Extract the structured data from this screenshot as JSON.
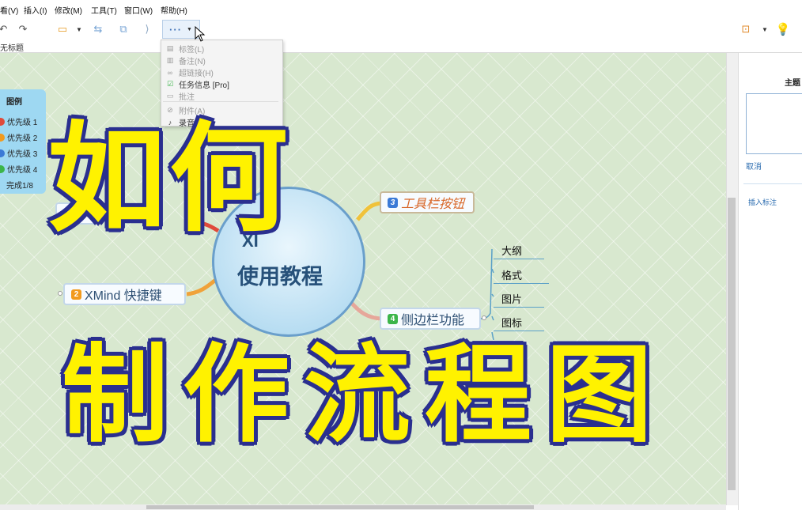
{
  "menu": [
    "看(V)",
    "插入(I)",
    "修改(M)",
    "工具(T)",
    "窗口(W)",
    "帮助(H)"
  ],
  "toolbar": {
    "more_label": "···"
  },
  "doc_tab": "无标题",
  "dropdown": {
    "items": [
      {
        "label": "标签(L)",
        "icon": "tag-icon",
        "enabled": false
      },
      {
        "label": "备注(N)",
        "icon": "note-icon",
        "enabled": false
      },
      {
        "label": "超链接(H)",
        "icon": "link-icon",
        "enabled": false
      },
      {
        "label": "任务信息 [Pro]",
        "icon": "task-icon",
        "enabled": true
      },
      {
        "label": "批注",
        "icon": "comment-icon",
        "enabled": false
      },
      {
        "label": "附件(A)",
        "icon": "paperclip-icon",
        "enabled": false
      },
      {
        "label": "录音 [Pro]",
        "icon": "mic-icon",
        "enabled": true
      }
    ]
  },
  "legend": {
    "title": "图例",
    "items": [
      {
        "label": "优先级 1",
        "color": "#e04a3a"
      },
      {
        "label": "优先级 2",
        "color": "#f29a1d"
      },
      {
        "label": "优先级 3",
        "color": "#3b7ad6"
      },
      {
        "label": "优先级 4",
        "color": "#3cb54a"
      },
      {
        "label": "完成1/8",
        "color": ""
      }
    ]
  },
  "mindmap": {
    "center_top": "XI",
    "center": "使用教程",
    "node_shortcuts": {
      "num": "2",
      "label": "XMind 快捷键",
      "color": "#f29a1d"
    },
    "node_toolbar": {
      "num": "3",
      "label": "工具栏按钮",
      "color": "#3b7ad6"
    },
    "node_sidebar": {
      "num": "4",
      "label": "侧边栏功能",
      "color": "#3cb54a"
    },
    "subtopics": [
      "大纲",
      "格式",
      "图片",
      "图标"
    ]
  },
  "right_panel": {
    "title": "主题",
    "cancel": "取消",
    "insert": "插入标注"
  },
  "overlay": {
    "line1": "如何",
    "line2": "制作流程图"
  }
}
